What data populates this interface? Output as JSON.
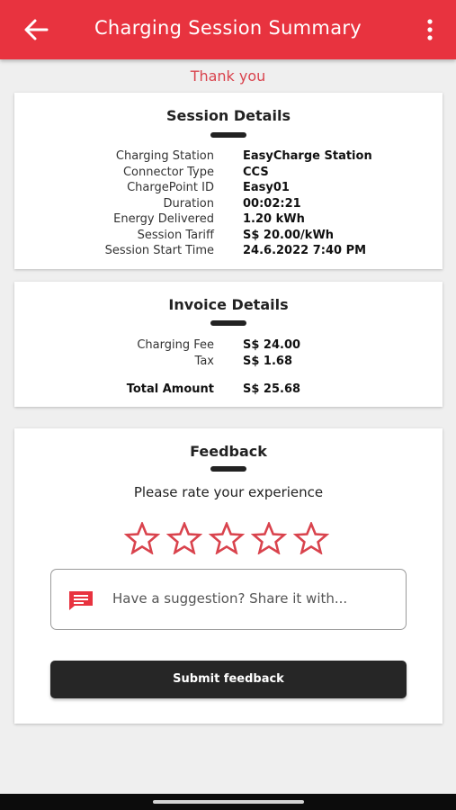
{
  "header": {
    "title": "Charging Session Summary",
    "back_icon": "arrow-left-icon",
    "menu_icon": "more-vert-icon"
  },
  "thank_you": "Thank you",
  "session_details": {
    "title": "Session Details",
    "rows": [
      {
        "label": "Charging Station",
        "value": "EasyCharge Station"
      },
      {
        "label": "Connector Type",
        "value": "CCS"
      },
      {
        "label": "ChargePoint ID",
        "value": "Easy01"
      },
      {
        "label": "Duration",
        "value": "00:02:21"
      },
      {
        "label": "Energy Delivered",
        "value": "1.20 kWh"
      },
      {
        "label": "Session Tariff",
        "value": "S$ 20.00/kWh"
      },
      {
        "label": "Session Start Time",
        "value": "24.6.2022 7:40 PM"
      }
    ]
  },
  "invoice_details": {
    "title": "Invoice Details",
    "rows": [
      {
        "label": "Charging Fee",
        "value": "S$ 24.00"
      },
      {
        "label": "Tax",
        "value": "S$ 1.68"
      }
    ],
    "total": {
      "label": "Total Amount",
      "value": "S$ 25.68"
    }
  },
  "feedback": {
    "title": "Feedback",
    "prompt": "Please rate your experience",
    "rating": 0,
    "max_rating": 5,
    "suggestion_placeholder": "Have a suggestion? Share it with...",
    "suggestion_icon": "chat-bubble-icon",
    "submit_label": "Submit feedback"
  },
  "colors": {
    "accent": "#e8333f",
    "star_outline": "#d9434d",
    "button": "#262626"
  }
}
